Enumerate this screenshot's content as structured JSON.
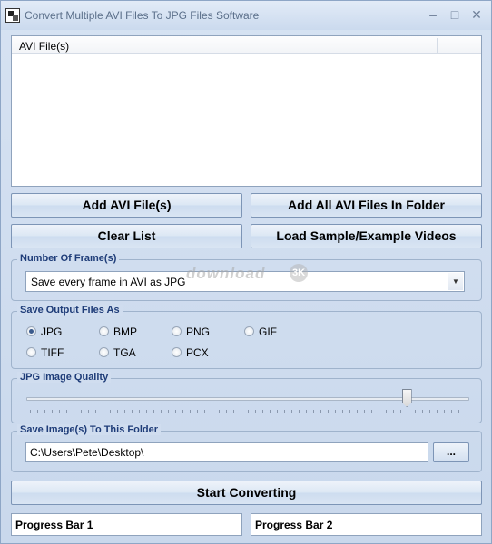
{
  "window": {
    "title": "Convert Multiple AVI Files To JPG Files Software",
    "minimize_glyph": "–",
    "maximize_glyph": "□",
    "close_glyph": "✕"
  },
  "file_list": {
    "column_header": "AVI File(s)"
  },
  "buttons": {
    "add_files": "Add AVI File(s)",
    "add_folder": "Add All AVI Files In Folder",
    "clear_list": "Clear List",
    "load_sample": "Load Sample/Example Videos",
    "start": "Start Converting",
    "browse": "..."
  },
  "frames_group": {
    "label": "Number Of Frame(s)",
    "selected": "Save every frame in AVI as JPG"
  },
  "output_group": {
    "label": "Save Output Files As",
    "options": [
      {
        "label": "JPG",
        "checked": true
      },
      {
        "label": "BMP",
        "checked": false
      },
      {
        "label": "PNG",
        "checked": false
      },
      {
        "label": "GIF",
        "checked": false
      },
      {
        "label": "TIFF",
        "checked": false
      },
      {
        "label": "TGA",
        "checked": false
      },
      {
        "label": "PCX",
        "checked": false
      }
    ]
  },
  "quality_group": {
    "label": "JPG Image Quality",
    "value_fraction": 0.86
  },
  "folder_group": {
    "label": "Save Image(s) To This Folder",
    "path": "C:\\Users\\Pete\\Desktop\\"
  },
  "progress": {
    "bar1": "Progress Bar 1",
    "bar2": "Progress Bar 2"
  },
  "watermark": {
    "text": "download",
    "logo": "3K"
  }
}
